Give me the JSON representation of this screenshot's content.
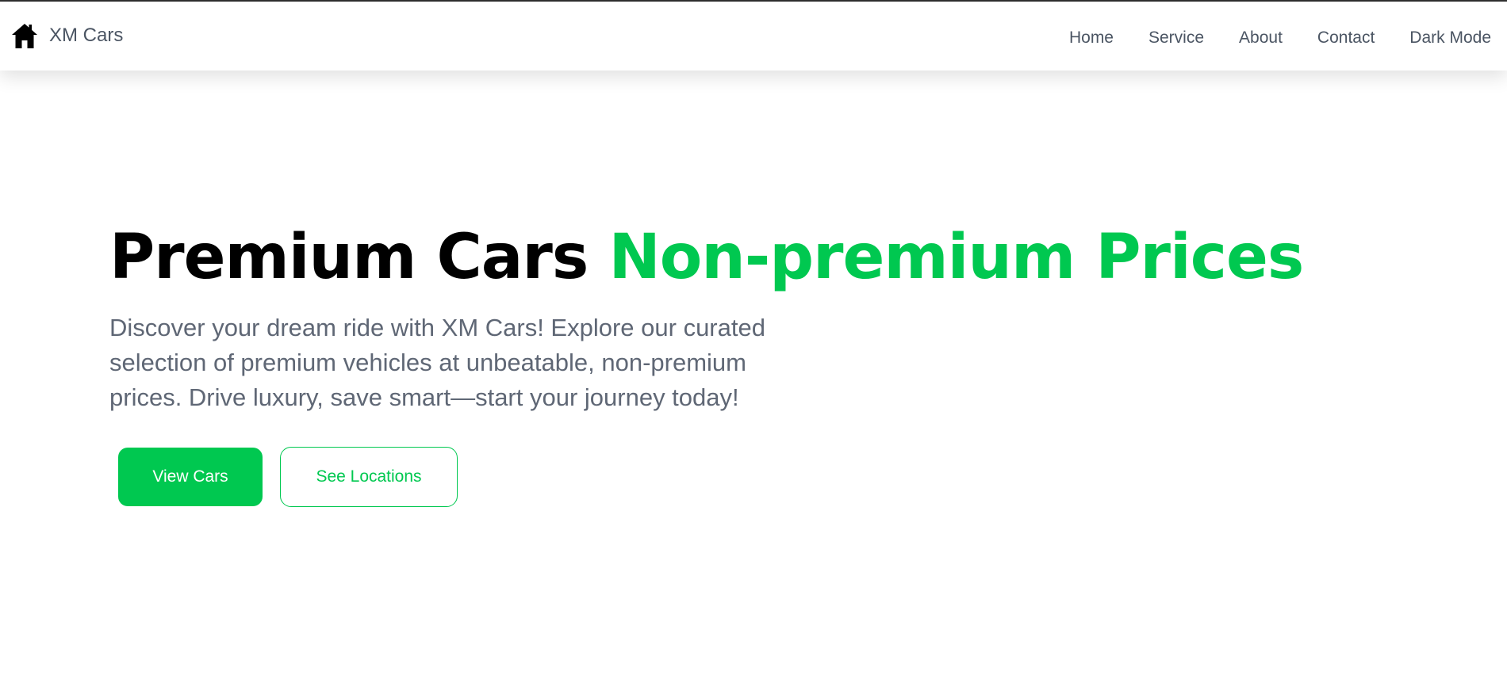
{
  "brand": {
    "name": "XM Cars",
    "icon": "home-icon"
  },
  "nav": {
    "items": [
      {
        "label": "Home"
      },
      {
        "label": "Service"
      },
      {
        "label": "About"
      },
      {
        "label": "Contact"
      },
      {
        "label": "Dark Mode"
      }
    ]
  },
  "hero": {
    "headline_part1": "Premium Cars",
    "headline_part2": "Non-premium Prices",
    "description": "Discover your dream ride with XM Cars! Explore our curated selection of premium vehicles at unbeatable, non-premium prices. Drive luxury, save smart—start your journey today!",
    "primary_button": "View Cars",
    "secondary_button": "See Locations"
  },
  "colors": {
    "accent": "#00c850",
    "text_muted": "#5f6775",
    "heading": "#000000"
  }
}
